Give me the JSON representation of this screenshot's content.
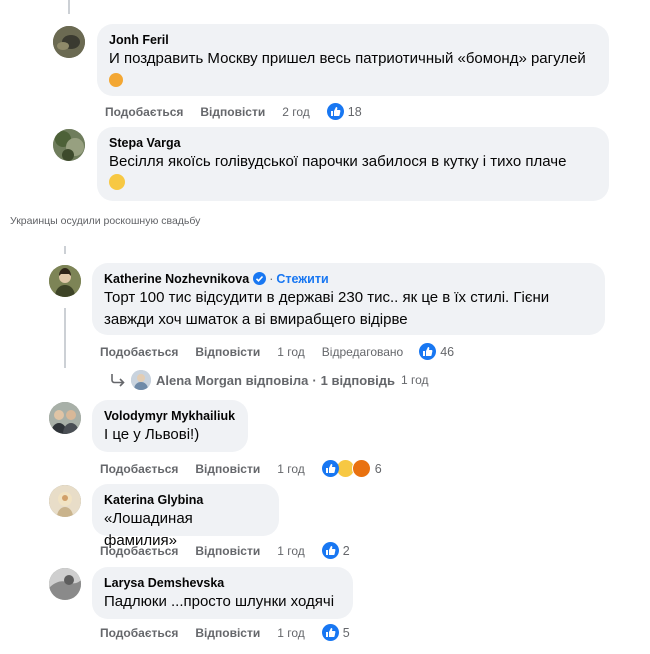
{
  "caption": "Украинцы осудили роскошную свадьбу",
  "comments_top": [
    {
      "author": "Jonh Feril",
      "text": "И поздравить Москву пришел весь патриотичный «бомонд» рагулей",
      "like": "Подобається",
      "reply": "Відповісти",
      "time": "2 год",
      "reactions": "18"
    },
    {
      "author": "Stepa Varga",
      "text": "Весілля якоїсь голівудської парочки забилося в кутку і тихо плаче"
    }
  ],
  "comments_bottom": [
    {
      "author": "Katherine Nozhevnikova",
      "follow": "Стежити",
      "text": "Торт 100 тис відсудити в державі 230 тис.. як це в їх стилі. Гієни завжди хоч шматок а ві вмирабщего відірве",
      "like": "Подобається",
      "reply": "Відповісти",
      "time": "1 год",
      "edited": "Відредаговано",
      "reactions": "46"
    },
    {
      "author": "Volodymyr Mykhailiuk",
      "text": "І це у Львові!)",
      "like": "Подобається",
      "reply": "Відповісти",
      "time": "1 год",
      "reactions": "6"
    },
    {
      "author": "Katerina Glybina",
      "text": "«Лошадиная фамилия»",
      "like": "Подобається",
      "reply": "Відповісти",
      "time": "1 год",
      "reactions": "2"
    },
    {
      "author": "Larysa Demshevska",
      "text": "Падлюки ...просто шлунки ходячі",
      "like": "Подобається",
      "reply": "Відповісти",
      "time": "1 год",
      "reactions": "5"
    }
  ],
  "reply_thread": {
    "author_reply": "Alena Morgan відповіла",
    "separator": "·",
    "count": "1 відповідь",
    "time": "1 год"
  },
  "colors": {
    "bubble": "#f0f2f5",
    "accent": "#1877f2",
    "meta": "#65676b"
  }
}
